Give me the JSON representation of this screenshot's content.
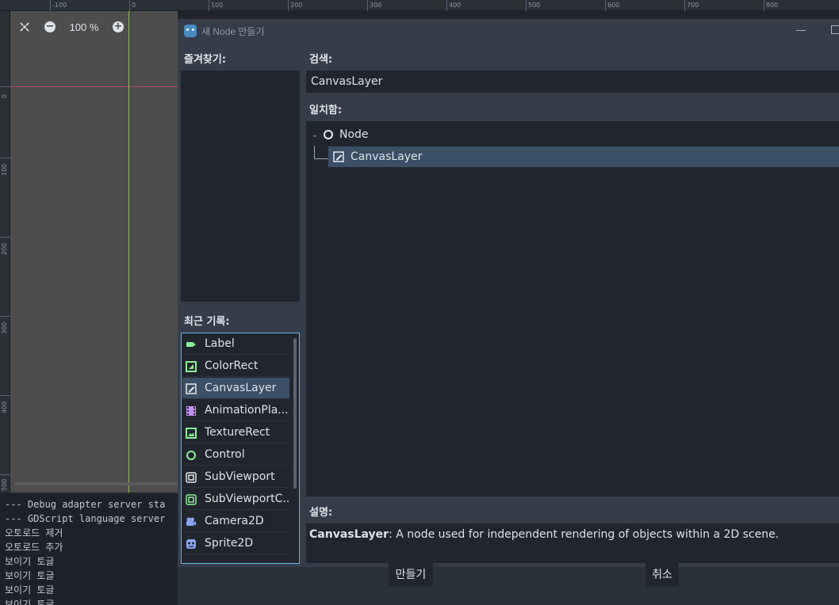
{
  "viewport": {
    "zoom_label": "100 %",
    "ruler_top_labels": [
      "-100",
      "0",
      "100",
      "200",
      "300",
      "400",
      "500",
      "600",
      "700",
      "800"
    ],
    "ruler_left_labels": [
      "0",
      "100",
      "200",
      "300",
      "400",
      "500"
    ]
  },
  "output_log": [
    "--- Debug adapter server sta",
    "--- GDScript language server",
    "오토로드 제거",
    "오토로드 추가",
    "보이기 토글",
    "보이기 토글",
    "보이기 토글",
    "보이기 토글"
  ],
  "dialog": {
    "title": "새 Node 만들기",
    "favorites_label": "즐겨찾기:",
    "recent_label": "최근 기록:",
    "search_label": "검색:",
    "search_value": "CanvasLayer",
    "matches_label": "일치함:",
    "tree": {
      "root": "Node",
      "child": "CanvasLayer"
    },
    "recent_items": [
      {
        "label": "Label",
        "icon": "label-icon"
      },
      {
        "label": "ColorRect",
        "icon": "colorrect-icon"
      },
      {
        "label": "CanvasLayer",
        "icon": "canvaslayer-icon",
        "selected": true
      },
      {
        "label": "AnimationPla...",
        "icon": "animationplayer-icon"
      },
      {
        "label": "TextureRect",
        "icon": "texturerect-icon"
      },
      {
        "label": "Control",
        "icon": "control-icon"
      },
      {
        "label": "SubViewport",
        "icon": "subviewport-icon"
      },
      {
        "label": "SubViewportC...",
        "icon": "subviewportcontainer-icon"
      },
      {
        "label": "Camera2D",
        "icon": "camera2d-icon"
      },
      {
        "label": "Sprite2D",
        "icon": "sprite2d-icon"
      }
    ],
    "description_label": "설명:",
    "description_name": "CanvasLayer",
    "description_text": ": A node used for independent rendering of objects within a 2D scene.",
    "create_button": "만들기",
    "cancel_button": "취소"
  },
  "colors": {
    "accent_blue": "#5fb6ef",
    "selected_row": "#3b4f66",
    "gui_green": "#8eef97",
    "node2d_blue": "#8da5f3",
    "animation_purple": "#c38ef1"
  }
}
